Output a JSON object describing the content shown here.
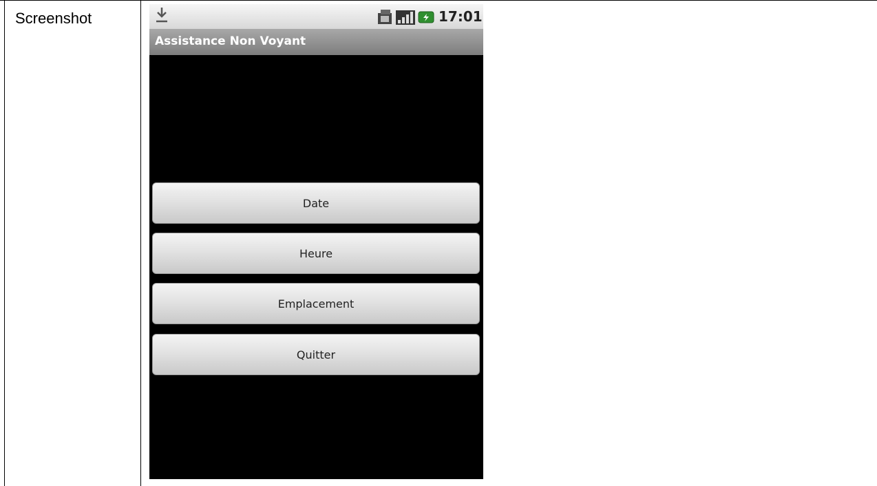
{
  "document": {
    "cell_label": "Screenshot"
  },
  "status_bar": {
    "time": "17:01",
    "icons": [
      "download-icon",
      "sim-card-icon",
      "signal-icon",
      "battery-icon"
    ]
  },
  "app": {
    "title": "Assistance Non Voyant",
    "buttons": [
      {
        "label": "Date"
      },
      {
        "label": "Heure"
      },
      {
        "label": "Emplacement"
      },
      {
        "label": "Quitter"
      }
    ]
  },
  "colors": {
    "screen_background": "#000000",
    "title_bar": "#8c8c8c",
    "button_face": "#e2e2e2"
  }
}
